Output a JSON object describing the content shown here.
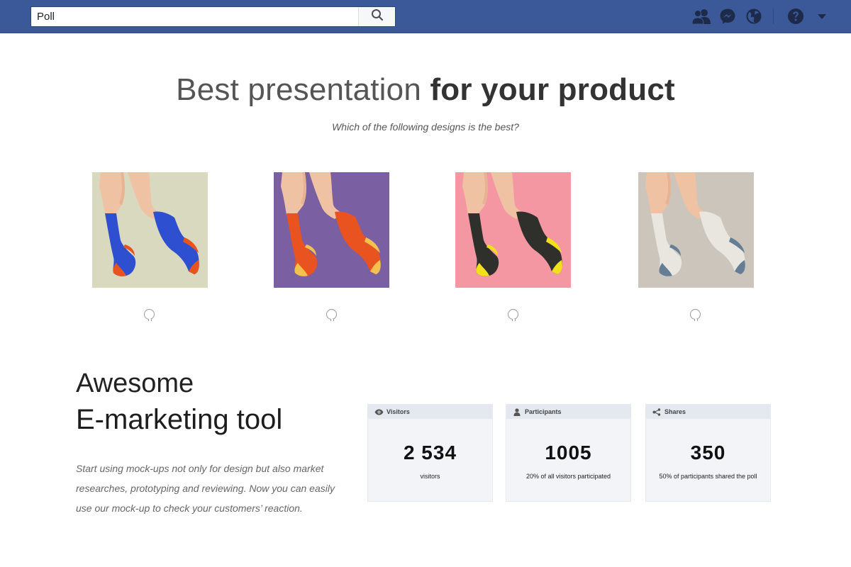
{
  "search": {
    "value": "Poll"
  },
  "hero": {
    "title_light": "Best presentation",
    "title_bold": "for your product",
    "subtitle": "Which of the following designs is the best?"
  },
  "options": [
    {
      "bg": "#d8d9bf",
      "sock": "#2f4fd1",
      "accent": "#e8531f"
    },
    {
      "bg": "#7a5fa3",
      "sock": "#e8531f",
      "accent": "#f2c14e"
    },
    {
      "bg": "#f597a3",
      "sock": "#2f302c",
      "accent": "#f1e01a"
    },
    {
      "bg": "#cbc5bb",
      "sock": "#e9e6e0",
      "accent": "#667d96"
    }
  ],
  "marketing": {
    "line1": "Awesome",
    "line2": "E-marketing tool",
    "description": "Start using mock-ups not only for design but also market researches, prototyping and reviewing. Now you can easily use our mock-up to check your customers’ reaction."
  },
  "stats": [
    {
      "label": "Visitors",
      "icon": "eye-icon",
      "value": "2 534",
      "caption": "visitors"
    },
    {
      "label": "Participants",
      "icon": "person-icon",
      "value": "1005",
      "caption": "20% of all visitors participated"
    },
    {
      "label": "Shares",
      "icon": "share-icon",
      "value": "350",
      "caption": "50% of participants shared the poll"
    }
  ],
  "colors": {
    "brand": "#3b5998"
  }
}
